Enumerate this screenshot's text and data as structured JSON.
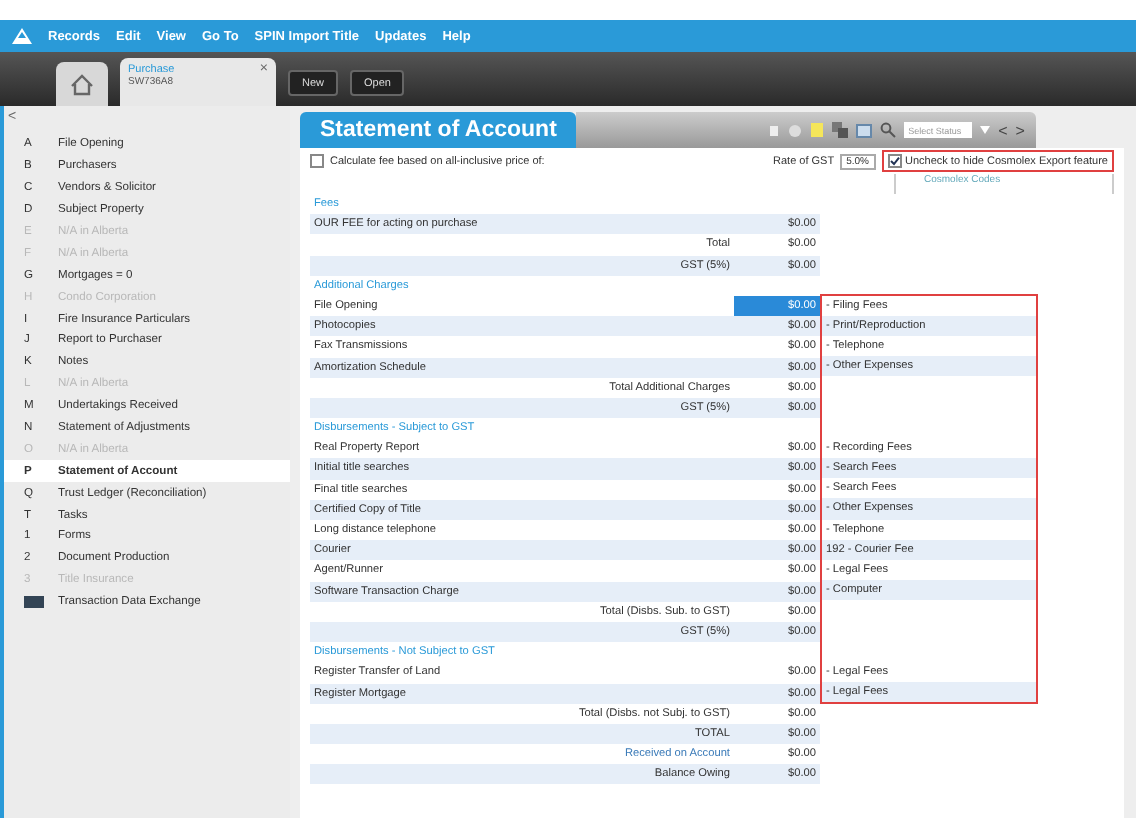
{
  "menu": [
    "Records",
    "Edit",
    "View",
    "Go To",
    "SPIN Import Title",
    "Updates",
    "Help"
  ],
  "file_tab": {
    "title": "Purchase",
    "number": "SW736A8",
    "close": "×"
  },
  "toolbar_buttons": [
    "New",
    "Open"
  ],
  "sidebar": {
    "collapse": "<",
    "items": [
      {
        "kind": "letter",
        "letter": "A",
        "label": "File Opening",
        "disabled": false,
        "selected": false
      },
      {
        "kind": "letter",
        "letter": "B",
        "label": "Purchasers",
        "disabled": false,
        "selected": false
      },
      {
        "kind": "letter",
        "letter": "C",
        "label": "Vendors & Solicitor",
        "disabled": false,
        "selected": false
      },
      {
        "kind": "letter",
        "letter": "D",
        "label": "Subject Property",
        "disabled": false,
        "selected": false
      },
      {
        "kind": "letter",
        "letter": "E",
        "label": "N/A in Alberta",
        "disabled": true,
        "selected": false
      },
      {
        "kind": "letter",
        "letter": "F",
        "label": "N/A in Alberta",
        "disabled": true,
        "selected": false
      },
      {
        "kind": "letter",
        "letter": "G",
        "label": "Mortgages = 0",
        "disabled": false,
        "selected": false
      },
      {
        "kind": "letter",
        "letter": "H",
        "label": "Condo Corporation",
        "disabled": true,
        "selected": false
      },
      {
        "kind": "letter",
        "letter": "I",
        "label": "Fire Insurance Particulars",
        "disabled": false,
        "selected": false
      },
      {
        "kind": "letter",
        "letter": "J",
        "label": "Report to Purchaser",
        "disabled": false,
        "selected": false
      },
      {
        "kind": "letter",
        "letter": "K",
        "label": "Notes",
        "disabled": false,
        "selected": false
      },
      {
        "kind": "letter",
        "letter": "L",
        "label": "N/A in Alberta",
        "disabled": true,
        "selected": false
      },
      {
        "kind": "letter",
        "letter": "M",
        "label": "Undertakings Received",
        "disabled": false,
        "selected": false
      },
      {
        "kind": "letter",
        "letter": "N",
        "label": "Statement of Adjustments",
        "disabled": false,
        "selected": false
      },
      {
        "kind": "letter",
        "letter": "O",
        "label": "N/A in Alberta",
        "disabled": true,
        "selected": false
      },
      {
        "kind": "letter",
        "letter": "P",
        "label": "Statement of Account",
        "disabled": false,
        "selected": true
      },
      {
        "kind": "letter",
        "letter": "Q",
        "label": "Trust Ledger (Reconciliation)",
        "disabled": false,
        "selected": false
      },
      {
        "kind": "letter",
        "letter": "T",
        "label": "Tasks",
        "disabled": false,
        "selected": false
      },
      {
        "kind": "letter",
        "letter": "1",
        "label": "Forms",
        "disabled": false,
        "selected": false
      },
      {
        "kind": "letter",
        "letter": "2",
        "label": "Document Production",
        "disabled": false,
        "selected": false
      },
      {
        "kind": "letter",
        "letter": "3",
        "label": "Title Insurance",
        "disabled": true,
        "selected": false
      },
      {
        "kind": "icon",
        "label": "Transaction Data Exchange",
        "disabled": false,
        "selected": false
      }
    ]
  },
  "page_title": "Statement of Account",
  "status_select": {
    "placeholder": "Select Status",
    "open": false
  },
  "nav": [
    "<",
    ">"
  ],
  "calc_checkbox": {
    "label": "Calculate fee based on all-inclusive price of:",
    "checked": false
  },
  "gst_rate": {
    "label": "Rate of GST",
    "value": "5.0%"
  },
  "export_checkbox": {
    "label": "Uncheck to hide Cosmolex Export feature",
    "checked": true,
    "outlined": true
  },
  "codes_column": {
    "heading": "Cosmolex Codes",
    "outlined": true
  },
  "rows": [
    {
      "kind": "header",
      "label": "Fees"
    },
    {
      "kind": "item",
      "label": "OUR FEE for acting on purchase",
      "amount": "$0.00",
      "selected": false
    },
    {
      "kind": "total",
      "label": "Total",
      "amount": "$0.00"
    },
    {
      "kind": "total",
      "label": "GST (5%)",
      "amount": "$0.00"
    },
    {
      "kind": "header",
      "label": "Additional Charges"
    },
    {
      "kind": "item",
      "label": "File Opening",
      "amount": "$0.00",
      "code": "- Filing Fees",
      "selected": true
    },
    {
      "kind": "item",
      "label": "Photocopies",
      "amount": "$0.00",
      "code": "- Print/Reproduction",
      "selected": false
    },
    {
      "kind": "item",
      "label": "Fax Transmissions",
      "amount": "$0.00",
      "code": "- Telephone",
      "selected": false
    },
    {
      "kind": "item",
      "label": "Amortization Schedule",
      "amount": "$0.00",
      "code": "- Other Expenses",
      "selected": false
    },
    {
      "kind": "total",
      "label": "Total Additional Charges",
      "amount": "$0.00"
    },
    {
      "kind": "total",
      "label": "GST (5%)",
      "amount": "$0.00"
    },
    {
      "kind": "header",
      "label": "Disbursements - Subject to GST"
    },
    {
      "kind": "item",
      "label": "Real Property Report",
      "amount": "$0.00",
      "code": "- Recording Fees",
      "selected": false
    },
    {
      "kind": "item",
      "label": "Initial title searches",
      "amount": "$0.00",
      "code": "- Search Fees",
      "selected": false
    },
    {
      "kind": "item",
      "label": "Final title searches",
      "amount": "$0.00",
      "code": "- Search Fees",
      "selected": false
    },
    {
      "kind": "item",
      "label": "Certified Copy of Title",
      "amount": "$0.00",
      "code": "- Other Expenses",
      "selected": false
    },
    {
      "kind": "item",
      "label": "Long distance telephone",
      "amount": "$0.00",
      "code": "- Telephone",
      "selected": false
    },
    {
      "kind": "item",
      "label": "Courier",
      "amount": "$0.00",
      "code": "192 - Courier Fee",
      "selected": false
    },
    {
      "kind": "item",
      "label": "Agent/Runner",
      "amount": "$0.00",
      "code": "- Legal Fees",
      "selected": false
    },
    {
      "kind": "item",
      "label": "Software Transaction Charge",
      "amount": "$0.00",
      "code": "- Computer",
      "selected": false
    },
    {
      "kind": "total",
      "label": "Total (Disbs. Sub. to GST)",
      "amount": "$0.00"
    },
    {
      "kind": "total",
      "label": "GST (5%)",
      "amount": "$0.00"
    },
    {
      "kind": "header",
      "label": "Disbursements - Not Subject to GST"
    },
    {
      "kind": "item",
      "label": "Register Transfer of Land",
      "amount": "$0.00",
      "code": "- Legal Fees",
      "selected": false
    },
    {
      "kind": "item",
      "label": "Register Mortgage",
      "amount": "$0.00",
      "code": "- Legal Fees",
      "selected": false
    },
    {
      "kind": "total",
      "label": "Total (Disbs. not Subj. to GST)",
      "amount": "$0.00"
    },
    {
      "kind": "total",
      "label": "TOTAL",
      "amount": "$0.00"
    },
    {
      "kind": "link",
      "label": "Received on Account",
      "amount": "$0.00"
    },
    {
      "kind": "total",
      "label": "Balance Owing",
      "amount": "$0.00"
    }
  ]
}
